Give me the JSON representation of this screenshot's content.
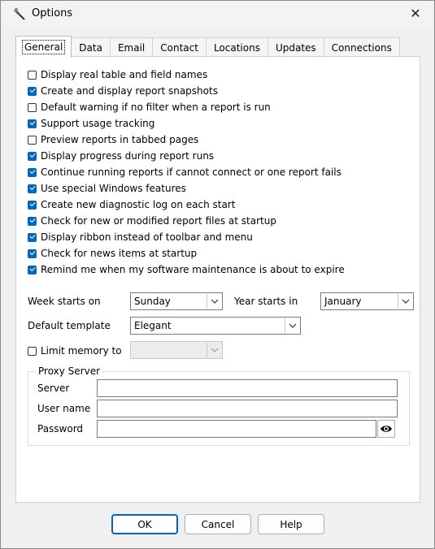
{
  "window": {
    "title": "Options"
  },
  "tabs": [
    "General",
    "Data",
    "Email",
    "Contact",
    "Locations",
    "Updates",
    "Connections"
  ],
  "options": [
    {
      "label": "Display real table and field names",
      "checked": false
    },
    {
      "label": "Create and display report snapshots",
      "checked": true
    },
    {
      "label": "Default warning if no filter when a report is run",
      "checked": false
    },
    {
      "label": "Support usage tracking",
      "checked": true
    },
    {
      "label": "Preview reports in tabbed pages",
      "checked": false
    },
    {
      "label": "Display progress during report runs",
      "checked": true
    },
    {
      "label": "Continue running reports if cannot connect or one report fails",
      "checked": true
    },
    {
      "label": "Use special Windows features",
      "checked": true
    },
    {
      "label": "Create new diagnostic log on each start",
      "checked": true
    },
    {
      "label": "Check for new or modified report files at startup",
      "checked": true
    },
    {
      "label": "Display ribbon instead of toolbar and menu",
      "checked": true
    },
    {
      "label": "Check for news items at startup",
      "checked": true
    },
    {
      "label": "Remind me when my software maintenance is about to expire",
      "checked": true
    }
  ],
  "settings": {
    "week_label": "Week starts on",
    "week_value": "Sunday",
    "year_label": "Year starts in",
    "year_value": "January",
    "template_label": "Default template",
    "template_value": "Elegant",
    "memory_label": "Limit memory to",
    "memory_checked": false,
    "memory_value": ""
  },
  "proxy": {
    "title": "Proxy Server",
    "server_label": "Server",
    "server_value": "",
    "user_label": "User name",
    "user_value": "",
    "password_label": "Password",
    "password_value": ""
  },
  "buttons": {
    "ok": "OK",
    "cancel": "Cancel",
    "help": "Help"
  },
  "colors": {
    "accent": "#0067c0"
  }
}
